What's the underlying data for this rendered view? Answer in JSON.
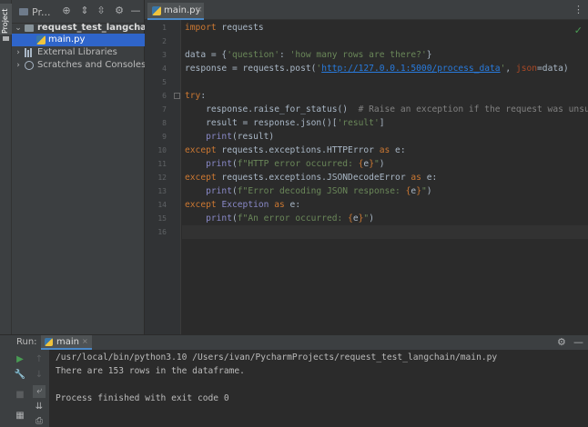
{
  "toolstrip": {
    "project_tab": "Project"
  },
  "project": {
    "header_title": "Pr...",
    "tree": [
      {
        "label": "request_test_langchain",
        "suffix": "~",
        "kind": "folder",
        "expanded": true
      },
      {
        "label": "main.py",
        "kind": "python-file",
        "selected": true
      },
      {
        "label": "External Libraries",
        "kind": "library",
        "expanded": false
      },
      {
        "label": "Scratches and Consoles",
        "kind": "scratch",
        "expanded": false
      }
    ]
  },
  "editor": {
    "tab_label": "main.py",
    "line_numbers": [
      "1",
      "2",
      "3",
      "4",
      "5",
      "6",
      "7",
      "8",
      "9",
      "10",
      "11",
      "12",
      "13",
      "14",
      "15",
      "16"
    ],
    "code": {
      "l1_kw": "import",
      "l1_rest": " requests",
      "l3_a": "data = {",
      "l3_s1": "'question'",
      "l3_b": ": ",
      "l3_s2": "'how many rows are there?'",
      "l3_c": "}",
      "l4_a": "response = requests.post(",
      "l4_q1": "'",
      "l4_url": "http://127.0.0.1:5000/process_data",
      "l4_q2": "'",
      "l4_b": ", ",
      "l4_param": "json",
      "l4_c": "=data)",
      "l6_kw": "try",
      "l6_rest": ":",
      "l7_code": "    response.raise_for_status()  ",
      "l7_cmt": "# Raise an exception if the request was unsuccessful",
      "l8_a": "    result = response.json()[",
      "l8_s": "'result'",
      "l8_b": "]",
      "l9_pad": "    ",
      "l9_bi": "print",
      "l9_rest": "(result)",
      "l10_kw": "except",
      "l10_mid": " requests.exceptions.HTTPError ",
      "l10_as": "as",
      "l10_rest": " e:",
      "l11_pad": "    ",
      "l11_bi": "print",
      "l11_a": "(",
      "l11_s1": "f\"HTTP error occurred: ",
      "l11_b1": "{",
      "l11_v": "e",
      "l11_b2": "}",
      "l11_s2": "\"",
      "l11_c": ")",
      "l12_kw": "except",
      "l12_mid": " requests.exceptions.JSONDecodeError ",
      "l12_as": "as",
      "l12_rest": " e:",
      "l13_pad": "    ",
      "l13_bi": "print",
      "l13_a": "(",
      "l13_s1": "f\"Error decoding JSON response: ",
      "l13_b1": "{",
      "l13_v": "e",
      "l13_b2": "}",
      "l13_s2": "\"",
      "l13_c": ")",
      "l14_kw": "except",
      "l14_sp": " ",
      "l14_bi": "Exception",
      "l14_sp2": " ",
      "l14_as": "as",
      "l14_rest": " e:",
      "l15_pad": "    ",
      "l15_bi": "print",
      "l15_a": "(",
      "l15_s1": "f\"An error occurred: ",
      "l15_b1": "{",
      "l15_v": "e",
      "l15_b2": "}",
      "l15_s2": "\"",
      "l15_c": ")"
    }
  },
  "run": {
    "title": "Run:",
    "tab_label": "main",
    "console": [
      "/usr/local/bin/python3.10 /Users/ivan/PycharmProjects/request_test_langchain/main.py",
      "There are 153 rows in the dataframe.",
      "",
      "Process finished with exit code 0"
    ]
  },
  "colors": {
    "keyword": "#cc7832",
    "string": "#6a8759",
    "link": "#287bde",
    "comment": "#808080",
    "builtin": "#8888c6",
    "selection": "#2f65ca",
    "ok_check": "#499c54"
  },
  "icons": [
    "gear-icon",
    "minimize-icon",
    "target-icon",
    "expand-all-icon",
    "collapse-all-icon",
    "run-icon",
    "wrench-icon",
    "stop-icon",
    "more-icon",
    "inspection-ok-icon"
  ]
}
